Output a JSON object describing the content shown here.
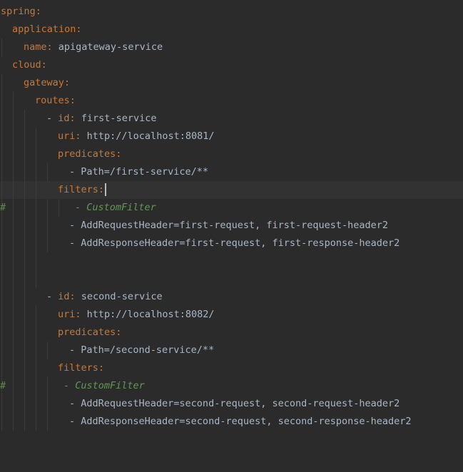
{
  "editor": {
    "language": "yaml",
    "lines": [
      {
        "indent": 0,
        "parts": [
          {
            "t": "spring",
            "c": "key"
          },
          {
            "t": ":",
            "c": "punct"
          }
        ]
      },
      {
        "indent": 1,
        "parts": [
          {
            "t": "application",
            "c": "key"
          },
          {
            "t": ":",
            "c": "punct"
          }
        ]
      },
      {
        "indent": 2,
        "parts": [
          {
            "t": "name",
            "c": "key"
          },
          {
            "t": ": ",
            "c": "punct"
          },
          {
            "t": "apigateway-service",
            "c": "val"
          }
        ]
      },
      {
        "indent": 1,
        "parts": [
          {
            "t": "cloud",
            "c": "key"
          },
          {
            "t": ":",
            "c": "punct"
          }
        ]
      },
      {
        "indent": 2,
        "parts": [
          {
            "t": "gateway",
            "c": "key"
          },
          {
            "t": ":",
            "c": "punct"
          }
        ]
      },
      {
        "indent": 3,
        "parts": [
          {
            "t": "routes",
            "c": "key"
          },
          {
            "t": ":",
            "c": "punct"
          }
        ]
      },
      {
        "indent": 4,
        "parts": [
          {
            "t": "- ",
            "c": "text"
          },
          {
            "t": "id",
            "c": "key"
          },
          {
            "t": ": ",
            "c": "punct"
          },
          {
            "t": "first-service",
            "c": "val"
          }
        ]
      },
      {
        "indent": 5,
        "parts": [
          {
            "t": "uri",
            "c": "key"
          },
          {
            "t": ": ",
            "c": "punct"
          },
          {
            "t": "http://localhost:8081/",
            "c": "val"
          }
        ]
      },
      {
        "indent": 5,
        "parts": [
          {
            "t": "predicates",
            "c": "key"
          },
          {
            "t": ":",
            "c": "punct"
          }
        ]
      },
      {
        "indent": 6,
        "parts": [
          {
            "t": "- Path=/first-service/**",
            "c": "text"
          }
        ]
      },
      {
        "indent": 5,
        "current": true,
        "caret": true,
        "parts": [
          {
            "t": "filters",
            "c": "key"
          },
          {
            "t": ":",
            "c": "punct"
          }
        ]
      },
      {
        "indent": 6.5,
        "commented": true,
        "parts": [
          {
            "t": "- CustomFilter",
            "c": "comment"
          }
        ]
      },
      {
        "indent": 6,
        "parts": [
          {
            "t": "- AddRequestHeader=first-request, first-request-header2",
            "c": "text"
          }
        ]
      },
      {
        "indent": 6,
        "parts": [
          {
            "t": "- AddResponseHeader=first-request, first-response-header2",
            "c": "text"
          }
        ]
      },
      {
        "indent": 0,
        "parts": []
      },
      {
        "indent": 0,
        "parts": []
      },
      {
        "indent": 4,
        "parts": [
          {
            "t": "- ",
            "c": "text"
          },
          {
            "t": "id",
            "c": "key"
          },
          {
            "t": ": ",
            "c": "punct"
          },
          {
            "t": "second-service",
            "c": "val"
          }
        ]
      },
      {
        "indent": 5,
        "parts": [
          {
            "t": "uri",
            "c": "key"
          },
          {
            "t": ": ",
            "c": "punct"
          },
          {
            "t": "http://localhost:8082/",
            "c": "val"
          }
        ]
      },
      {
        "indent": 5,
        "parts": [
          {
            "t": "predicates",
            "c": "key"
          },
          {
            "t": ":",
            "c": "punct"
          }
        ]
      },
      {
        "indent": 6,
        "parts": [
          {
            "t": "- Path=/second-service/**",
            "c": "text"
          }
        ]
      },
      {
        "indent": 5,
        "parts": [
          {
            "t": "filters",
            "c": "key"
          },
          {
            "t": ":",
            "c": "punct"
          }
        ]
      },
      {
        "indent": 5.5,
        "commented": true,
        "parts": [
          {
            "t": "- CustomFilter",
            "c": "comment"
          }
        ]
      },
      {
        "indent": 6,
        "parts": [
          {
            "t": "- AddRequestHeader=second-request, second-request-header2",
            "c": "text"
          }
        ]
      },
      {
        "indent": 6,
        "parts": [
          {
            "t": "- AddResponseHeader=second-request, second-response-header2",
            "c": "text"
          }
        ]
      }
    ],
    "comment_marker": "#",
    "colors": {
      "background": "#2b2b2b",
      "current_line": "#323232",
      "key": "#cc7832",
      "value": "#a9b7c6",
      "comment": "#629755"
    }
  }
}
